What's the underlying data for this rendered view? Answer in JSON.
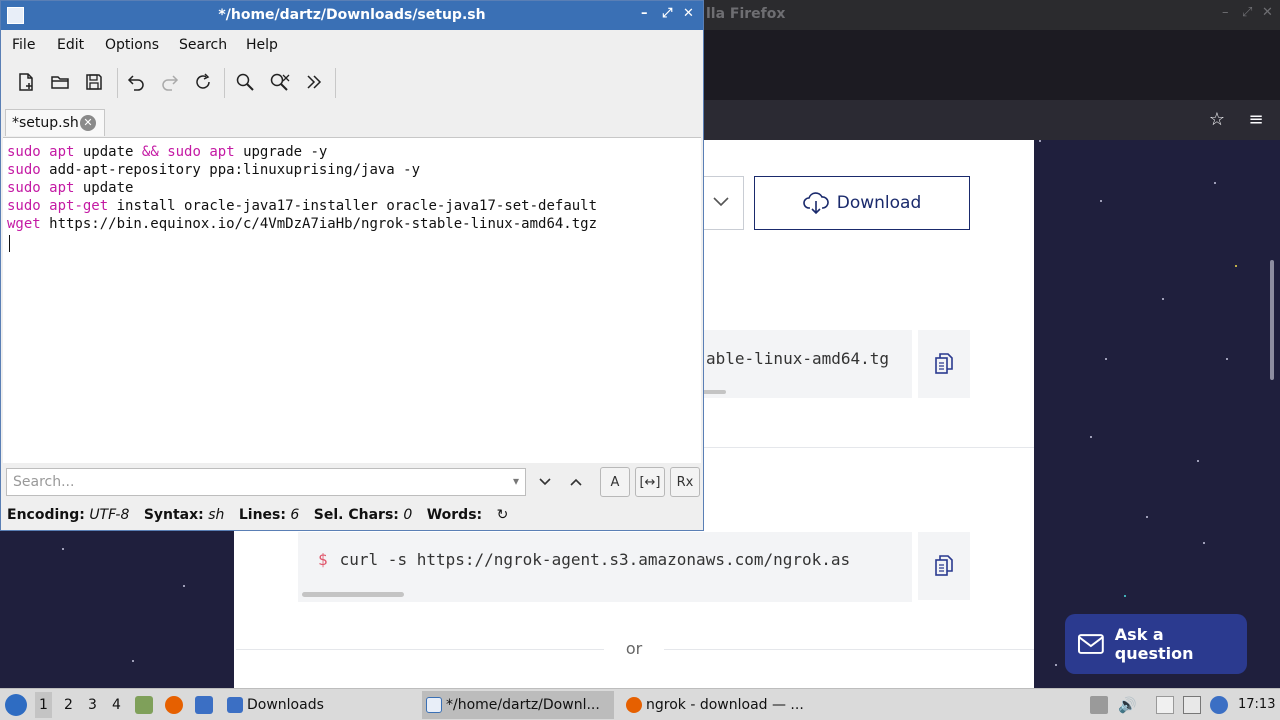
{
  "firefox": {
    "title_partial": "lla Firefox",
    "download_button": "Download",
    "code_snippet_1": "able-linux-amd64.tg",
    "code_snippet_2_prompt": "$",
    "code_snippet_2": "curl -s https://ngrok-agent.s3.amazonaws.com/ngrok.as",
    "or_label": "or",
    "ask_button": "Ask a question",
    "window_controls": [
      "–",
      "⤢",
      "✕"
    ]
  },
  "editor": {
    "title": "*/home/dartz/Downloads/setup.sh",
    "window_controls": [
      "–",
      "⤢",
      "✕"
    ],
    "menu": [
      "File",
      "Edit",
      "Options",
      "Search",
      "Help"
    ],
    "toolbar_icons": [
      "new-file-icon",
      "open-folder-icon",
      "save-icon",
      "undo-icon",
      "redo-icon",
      "reload-icon",
      "find-icon",
      "replace-icon",
      "more-icon"
    ],
    "tab_label": "*setup.sh",
    "lines": [
      [
        {
          "t": "sudo",
          "k": 1
        },
        {
          "t": " "
        },
        {
          "t": "apt",
          "k": 1
        },
        {
          "t": " update "
        },
        {
          "t": "&&",
          "k": 1
        },
        {
          "t": " "
        },
        {
          "t": "sudo",
          "k": 1
        },
        {
          "t": " "
        },
        {
          "t": "apt",
          "k": 1
        },
        {
          "t": " upgrade -y"
        }
      ],
      [
        {
          "t": "sudo",
          "k": 1
        },
        {
          "t": " add-apt-repository ppa:linuxuprising/java -y"
        }
      ],
      [
        {
          "t": "sudo",
          "k": 1
        },
        {
          "t": " "
        },
        {
          "t": "apt",
          "k": 1
        },
        {
          "t": " update"
        }
      ],
      [
        {
          "t": "sudo",
          "k": 1
        },
        {
          "t": " "
        },
        {
          "t": "apt-get",
          "k": 1
        },
        {
          "t": " install oracle-java17-installer oracle-java17-set-default"
        }
      ],
      [
        {
          "t": "wget",
          "k": 1
        },
        {
          "t": " https://bin.equinox.io/c/4VmDzA7iaHb/ngrok-stable-linux-amd64.tgz"
        }
      ],
      [
        {
          "t": ""
        }
      ]
    ],
    "search_placeholder": "Search...",
    "find_buttons": {
      "case": "A",
      "whole": "[↔]",
      "regex": "Rx"
    },
    "status": {
      "encoding_label": "Encoding:",
      "encoding": "UTF-8",
      "syntax_label": "Syntax:",
      "syntax": "sh",
      "lines_label": "Lines:",
      "lines": "6",
      "sel_label": "Sel. Chars:",
      "sel": "0",
      "words_label": "Words:"
    }
  },
  "taskbar": {
    "workspaces": [
      "1",
      "2",
      "3",
      "4"
    ],
    "tasks": [
      {
        "label": "Downloads",
        "active": false
      },
      {
        "label": "*/home/dartz/Downl...",
        "active": true
      },
      {
        "label": "ngrok - download — ...",
        "active": false
      }
    ],
    "clock": "17:13"
  }
}
